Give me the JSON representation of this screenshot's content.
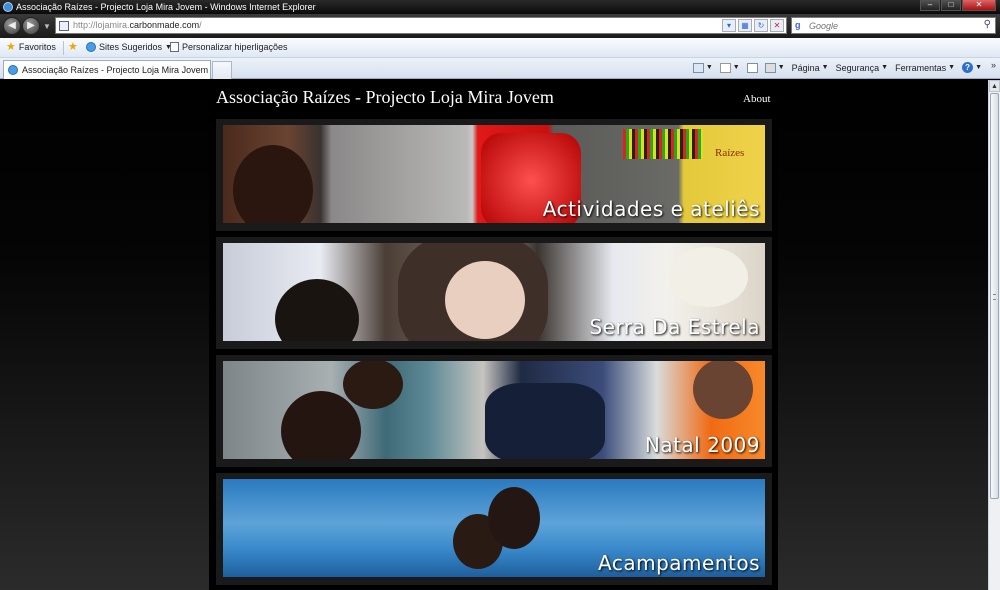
{
  "window": {
    "title": "Associação Raízes - Projecto Loja Mira Jovem - Windows Internet Explorer"
  },
  "address_bar": {
    "url_prefix": "http://lojamira.",
    "url_domain": "carbonmade.com",
    "url_suffix": "/"
  },
  "search": {
    "placeholder": "Google"
  },
  "favorites_bar": {
    "favorites_label": "Favoritos",
    "suggested_label": "Sites Sugeridos",
    "customize_label": "Personalizar hiperligações"
  },
  "tab": {
    "label": "Associação Raízes - Projecto Loja Mira Jovem"
  },
  "commands": {
    "page_label": "Página",
    "safety_label": "Segurança",
    "tools_label": "Ferramentas"
  },
  "page": {
    "site_title": "Associação Raízes - Projecto Loja Mira Jovem",
    "about_link": "About",
    "logo_text": "Raízes",
    "banners": [
      {
        "caption": "Actividades e ateliês"
      },
      {
        "caption": "Serra Da Estrela"
      },
      {
        "caption": "Natal 2009"
      },
      {
        "caption": "Acampamentos"
      }
    ]
  },
  "colors": {
    "page_background": "#000000",
    "banner_frame": "#1a1a1a",
    "text": "#ffffff"
  }
}
